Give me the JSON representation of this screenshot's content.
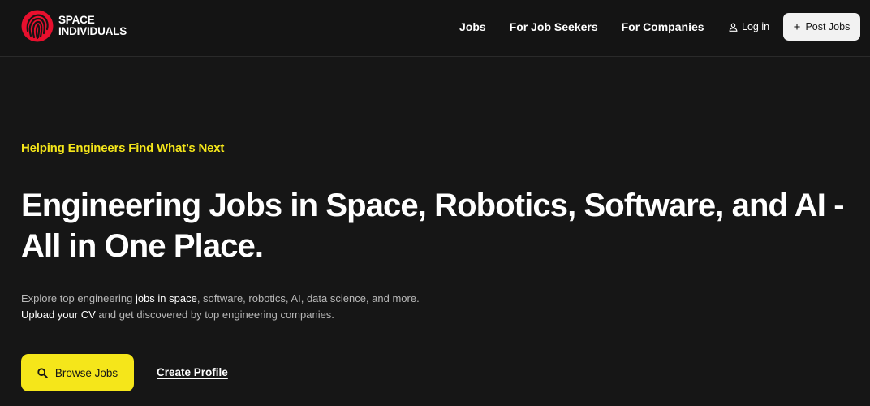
{
  "brand": {
    "name_line1": "SPACE",
    "name_line2": "INDIVIDUALS",
    "logo_icon": "fingerprint-icon",
    "logo_color": "#e8102e"
  },
  "nav": {
    "items": [
      {
        "label": "Jobs"
      },
      {
        "label": "For Job Seekers"
      },
      {
        "label": "For Companies"
      }
    ],
    "login_label": "Log in",
    "login_icon": "user-icon",
    "post_jobs_label": "Post Jobs",
    "post_jobs_icon": "plus-icon"
  },
  "hero": {
    "eyebrow": "Helping Engineers Find What’s Next",
    "headline_line1": "Engineering Jobs in Space, Robotics, Software, and AI -",
    "headline_line2": "All in One Place.",
    "desc_line1_pre": "Explore top engineering ",
    "desc_line1_link": "jobs in space",
    "desc_line1_post": ", software, robotics, AI, data science, and more.",
    "desc_line2_link": "Upload your CV",
    "desc_line2_post": " and get discovered by top engineering companies.",
    "browse_label": "Browse Jobs",
    "browse_icon": "search-icon",
    "create_profile_label": "Create Profile"
  },
  "colors": {
    "accent": "#f5e61a",
    "background": "#161616",
    "text": "#ffffff",
    "muted": "#b8b8b8"
  }
}
